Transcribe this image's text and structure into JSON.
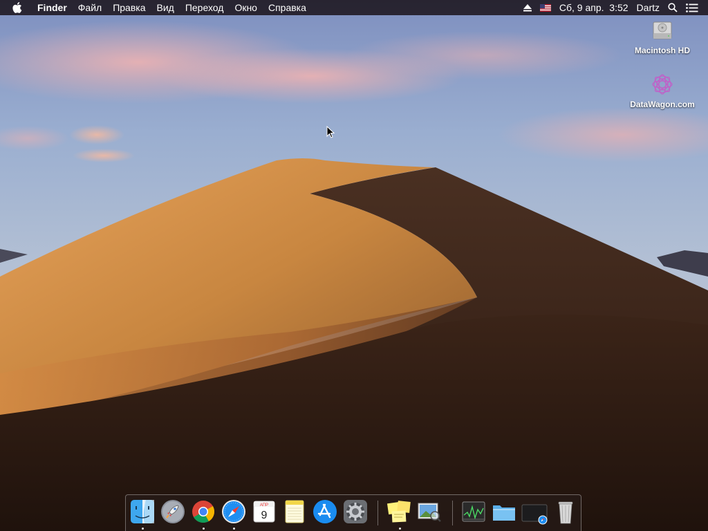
{
  "menubar": {
    "app_name": "Finder",
    "items": [
      "Файл",
      "Правка",
      "Вид",
      "Переход",
      "Окно",
      "Справка"
    ],
    "datetime": "Сб, 9 апр.  3:52",
    "user": "Dartz"
  },
  "desktop": {
    "icons": [
      {
        "label": "Macintosh HD",
        "icon": "hard-drive-icon"
      },
      {
        "label": "DataWagon.com",
        "icon": "network-volume-icon"
      }
    ]
  },
  "dock": {
    "calendar_month": "АПР",
    "calendar_day": "9",
    "apps": [
      {
        "name": "Finder",
        "icon": "finder-icon"
      },
      {
        "name": "Launchpad",
        "icon": "rocket-icon"
      },
      {
        "name": "Chrome",
        "icon": "chrome-icon"
      },
      {
        "name": "Safari",
        "icon": "compass-icon"
      },
      {
        "name": "Calendar",
        "icon": "calendar-icon"
      },
      {
        "name": "Notes",
        "icon": "notes-icon"
      },
      {
        "name": "App Store",
        "icon": "app-store-icon"
      },
      {
        "name": "System Preferences",
        "icon": "gear-icon"
      },
      {
        "name": "Stickies",
        "icon": "stickies-icon"
      },
      {
        "name": "Preview",
        "icon": "preview-icon"
      },
      {
        "name": "Activity Monitor",
        "icon": "activity-monitor-icon"
      },
      {
        "name": "Folder",
        "icon": "folder-icon"
      },
      {
        "name": "Window",
        "icon": "window-icon"
      },
      {
        "name": "Trash",
        "icon": "trash-icon"
      }
    ]
  },
  "colors": {
    "menubar_bg": "#1c161e",
    "sky_top": "#7a8ab8",
    "dune_light": "#d99a50",
    "dune_shadow": "#3a2418"
  }
}
